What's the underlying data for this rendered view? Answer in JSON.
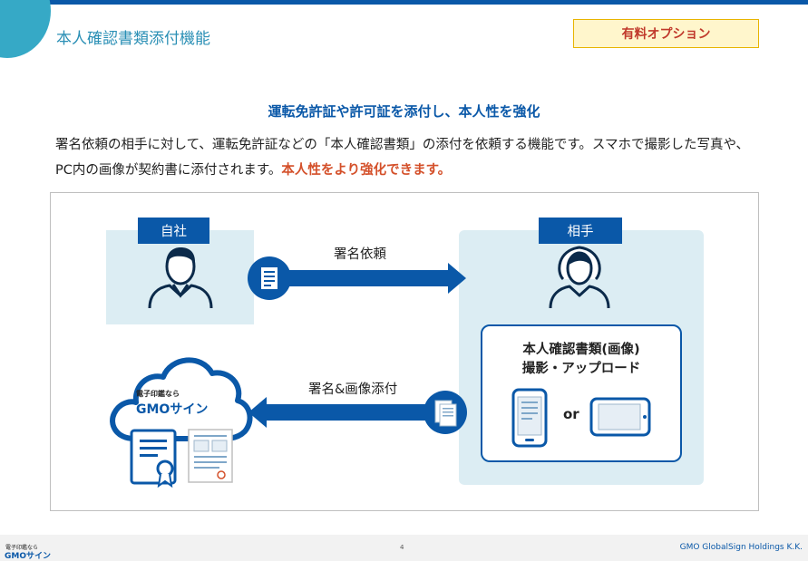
{
  "header": {
    "title": "本人確認書類添付機能",
    "option_badge": "有料オプション"
  },
  "headline": "運転免許証や許可証を添付し、本人性を強化",
  "description": {
    "text": "署名依頼の相手に対して、運転免許証などの「本人確認書類」の添付を依頼する機能です。スマホで撮影した写真や、PC内の画像が契約書に添付されます。",
    "emphasis": "本人性をより強化できます。"
  },
  "diagram": {
    "self_label": "自社",
    "other_label": "相手",
    "request_arrow_label": "署名依頼",
    "return_arrow_label": "署名&画像添付",
    "id_docs_title_line1": "本人確認書類(画像)",
    "id_docs_title_line2": "撮影・アップロード",
    "or_label": "or",
    "cloud_small_text": "電子印鑑なら",
    "cloud_logo_text": "GMOサイン"
  },
  "footer": {
    "logo_small": "電子印鑑なら",
    "logo": "GMOサイン",
    "page_number": "4",
    "company": "GMO GlobalSign Holdings K.K."
  },
  "colors": {
    "brand_blue": "#0a58a8",
    "accent_teal": "#36a9c6",
    "emphasis_red": "#d4502a",
    "panel_bg": "#dcedf3"
  },
  "icons": {
    "self_person": "man-avatar-icon",
    "other_person": "woman-avatar-icon",
    "request_document": "document-icon",
    "attached_document": "document-stack-icon",
    "smartphone": "smartphone-icon",
    "tablet": "tablet-icon",
    "certificate": "certificate-icon"
  }
}
